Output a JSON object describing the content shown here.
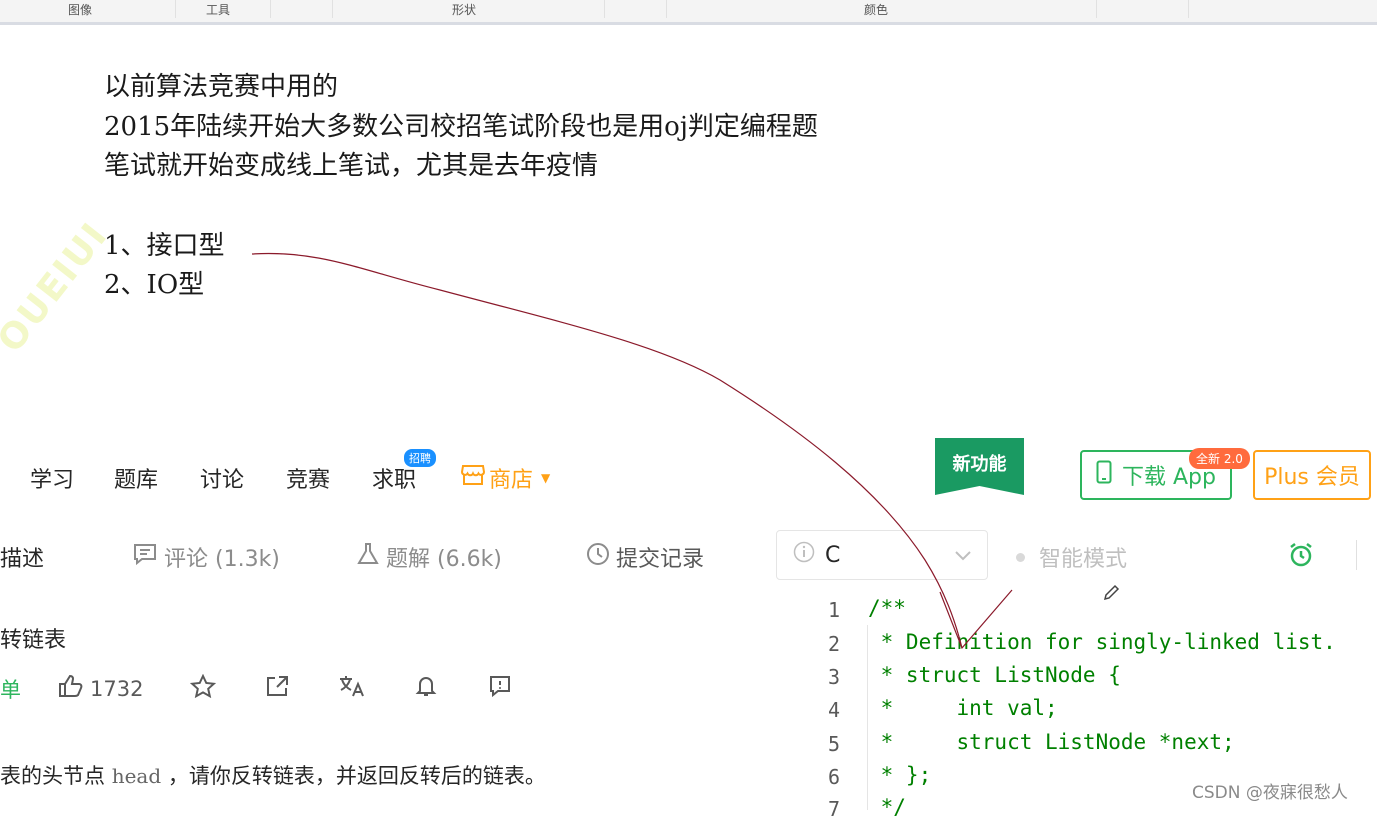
{
  "ribbon": {
    "labels": [
      "图像",
      "工具",
      "形状",
      "颜色"
    ]
  },
  "note": {
    "lines": [
      "以前算法竞赛中用的",
      "2015年陆续开始大多数公司校招笔试阶段也是用oj判定编程题",
      "笔试就开始变成线上笔试，尤其是去年疫情"
    ],
    "list": [
      "1、接口型",
      "2、IO型"
    ]
  },
  "nav": {
    "items": [
      "学习",
      "题库",
      "讨论",
      "竞赛",
      "求职"
    ],
    "hire_badge": "招聘",
    "shop": "商店",
    "new_feature": "新功能",
    "download": "下载 App",
    "download_badge": "全新 2.0",
    "plus": "Plus 会员"
  },
  "tabs": {
    "description": "描述",
    "comments": "评论 (1.3k)",
    "solutions": "题解 (6.6k)",
    "submissions": "提交记录"
  },
  "editor": {
    "language": "C",
    "smart_mode": "智能模式",
    "line_numbers": [
      "1",
      "2",
      "3",
      "4",
      "5",
      "6",
      "7"
    ],
    "lines": [
      "/**",
      " * Definition for singly-linked list.",
      " * struct ListNode {",
      " *     int val;",
      " *     struct ListNode *next;",
      " * };",
      " */"
    ]
  },
  "problem": {
    "title": "转链表",
    "difficulty": "单",
    "likes": "1732",
    "desc_prefix": "表的头节点",
    "desc_code": "head",
    "desc_suffix": "，请你反转链表，并返回反转后的链表。"
  },
  "footer": {
    "credit": "CSDN @夜寐很愁人"
  },
  "colors": {
    "green": "#2db55d",
    "orange": "#ffa116",
    "annotation": "#8b1a2b"
  }
}
